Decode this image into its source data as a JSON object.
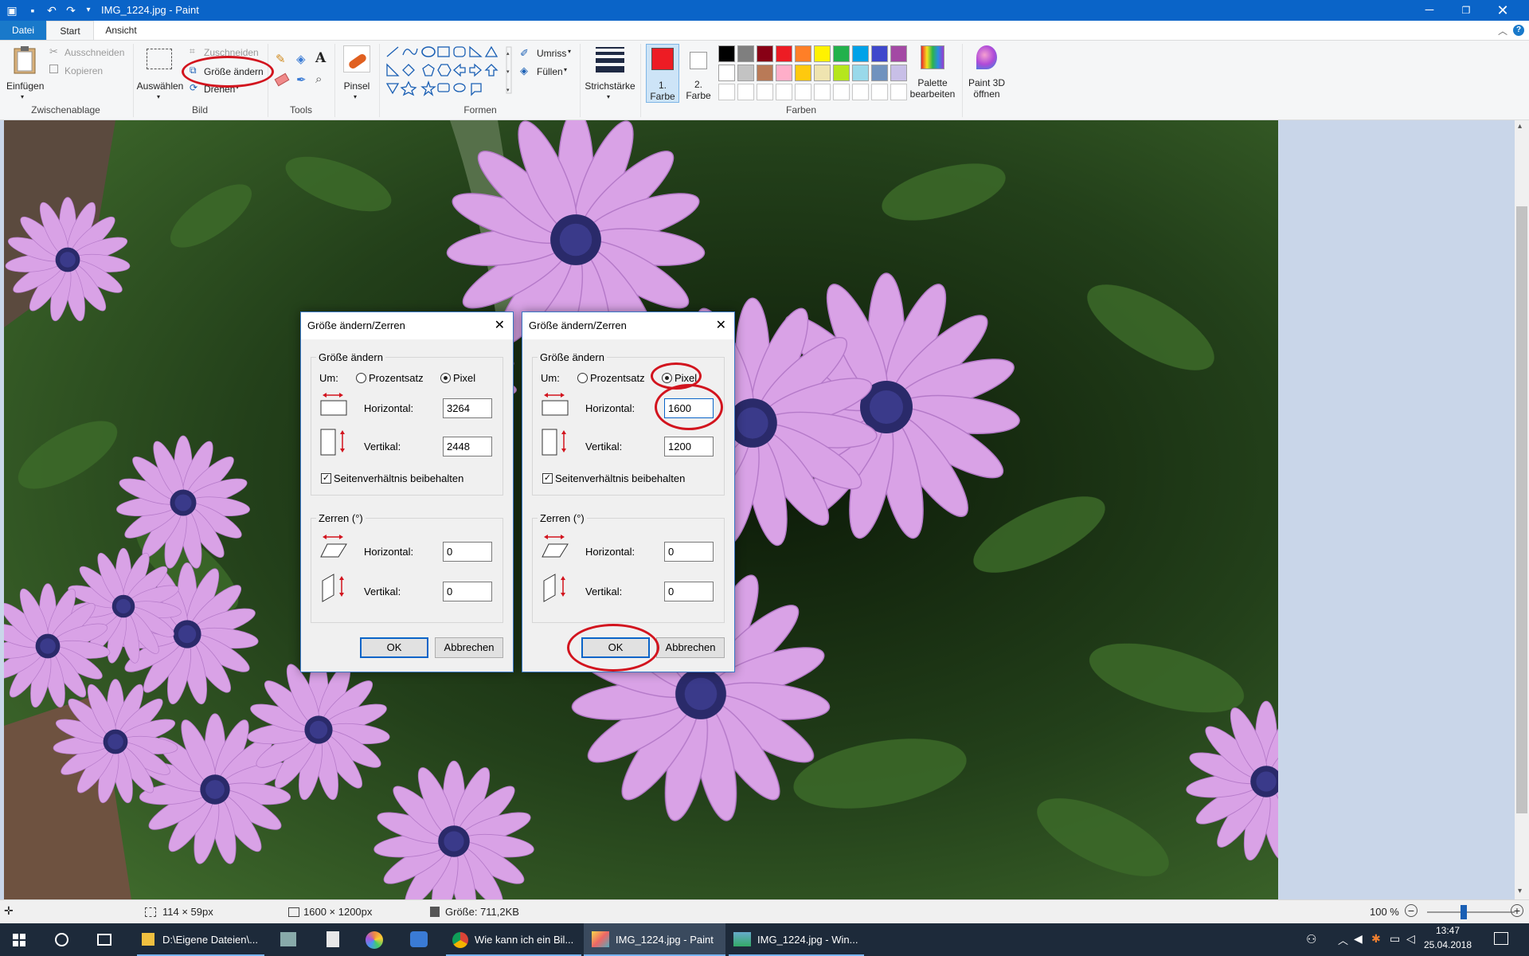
{
  "window": {
    "title": "IMG_1224.jpg - Paint"
  },
  "menu": {
    "tabs": [
      "Datei",
      "Start",
      "Ansicht"
    ]
  },
  "ribbon": {
    "clipboard": {
      "group_label": "Zwischenablage",
      "paste_label": "Einfügen",
      "cut_label": "Ausschneiden",
      "copy_label": "Kopieren"
    },
    "image": {
      "group_label": "Bild",
      "select_label": "Auswählen",
      "crop_label": "Zuschneiden",
      "resize_label": "Größe ändern",
      "rotate_label": "Drehen"
    },
    "tools": {
      "group_label": "Tools"
    },
    "brush": {
      "label": "Pinsel"
    },
    "shapes": {
      "group_label": "Formen",
      "outline_label": "Umriss",
      "fill_label": "Füllen"
    },
    "stroke": {
      "label": "Strichstärke"
    },
    "colors": {
      "group_label": "Farben",
      "color1_label_1": "1.",
      "color1_label_2": "Farbe",
      "color2_label_1": "2.",
      "color2_label_2": "Farbe",
      "color1": "#ed1c24",
      "color2": "#ffffff",
      "palette_row1": [
        "#000000",
        "#7f7f7f",
        "#880015",
        "#ed1c24",
        "#ff7f27",
        "#fff200",
        "#22b14c",
        "#00a2e8",
        "#3f48cc",
        "#a349a4"
      ],
      "palette_row2": [
        "#ffffff",
        "#c3c3c3",
        "#b97a57",
        "#ffaec9",
        "#ffc90e",
        "#efe4b0",
        "#b5e61d",
        "#99d9ea",
        "#7092be",
        "#c8bfe7"
      ],
      "edit_palette_label_1": "Palette",
      "edit_palette_label_2": "bearbeiten",
      "paint3d_label_1": "Paint 3D",
      "paint3d_label_2": "öffnen"
    }
  },
  "dialogs": [
    {
      "title": "Größe ändern/Zerren",
      "resize_legend": "Größe ändern",
      "um_label": "Um:",
      "percent_label": "Prozentsatz",
      "pixel_label": "Pixel",
      "pixel_selected": true,
      "horizontal_label": "Horizontal:",
      "horizontal_value": "3264",
      "vertical_label": "Vertikal:",
      "vertical_value": "2448",
      "keep_ratio_label": "Seitenverhältnis beibehalten",
      "skew_legend": "Zerren (°)",
      "skew_horizontal_label": "Horizontal:",
      "skew_horizontal_value": "0",
      "skew_vertical_label": "Vertikal:",
      "skew_vertical_value": "0",
      "ok_label": "OK",
      "cancel_label": "Abbrechen"
    },
    {
      "title": "Größe ändern/Zerren",
      "resize_legend": "Größe ändern",
      "um_label": "Um:",
      "percent_label": "Prozentsatz",
      "pixel_label": "Pixel",
      "pixel_selected": true,
      "horizontal_label": "Horizontal:",
      "horizontal_value": "1600",
      "vertical_label": "Vertikal:",
      "vertical_value": "1200",
      "keep_ratio_label": "Seitenverhältnis beibehalten",
      "skew_legend": "Zerren (°)",
      "skew_horizontal_label": "Horizontal:",
      "skew_horizontal_value": "0",
      "skew_vertical_label": "Vertikal:",
      "skew_vertical_value": "0",
      "ok_label": "OK",
      "cancel_label": "Abbrechen"
    }
  ],
  "statusbar": {
    "selection_size": "114 × 59px",
    "image_size": "1600 × 1200px",
    "file_size": "Größe: 711,2KB",
    "zoom": "100 %"
  },
  "taskbar": {
    "items": [
      {
        "label": "D:\\Eigene Dateien\\..."
      },
      {
        "label": "Wie kann ich ein Bil..."
      },
      {
        "label": "IMG_1224.jpg - Paint"
      },
      {
        "label": "IMG_1224.jpg - Win..."
      }
    ],
    "time": "13:47",
    "date": "25.04.2018"
  },
  "annotation_color": "#d2141e"
}
